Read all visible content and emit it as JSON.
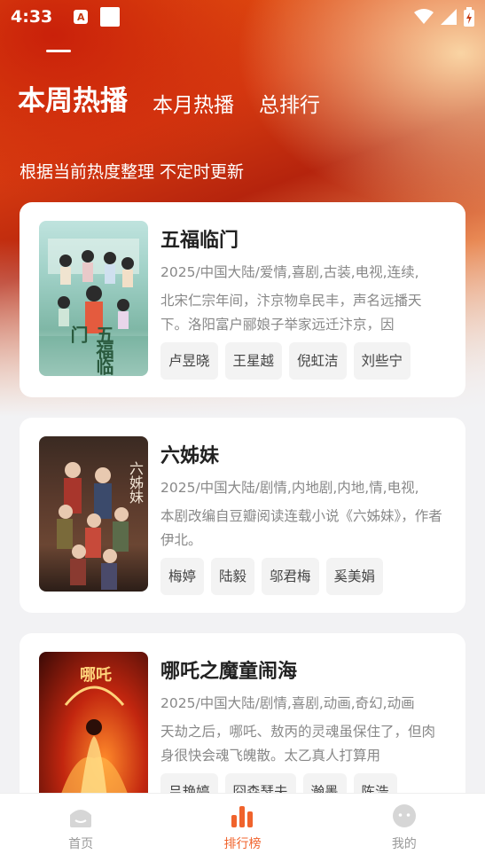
{
  "status": {
    "time": "4:33",
    "a_icon": "A"
  },
  "tabs": [
    {
      "label": "本周热播"
    },
    {
      "label": "本月热播"
    },
    {
      "label": "总排行"
    }
  ],
  "subtitle": "根据当前热度整理 不定时更新",
  "items": [
    {
      "title": "五福临门",
      "meta": "2025/中国大陆/爱情,喜剧,古装,电视,连续,",
      "desc": "北宋仁宗年间，汴京物阜民丰，声名远播天下。洛阳富户郦娘子举家远迁汴京，因",
      "cast": [
        "卢昱晓",
        "王星越",
        "倪虹洁",
        "刘些宁"
      ],
      "poster_text": "五福临门"
    },
    {
      "title": "六姊妹",
      "meta": "2025/中国大陆/剧情,内地剧,内地,情,电视,",
      "desc": "本剧改编自豆瓣阅读连载小说《六姊妹》，作者伊北。",
      "cast": [
        "梅婷",
        "陆毅",
        "邬君梅",
        "奚美娟"
      ],
      "poster_text": "六姊妹"
    },
    {
      "title": "哪吒之魔童闹海",
      "meta": "2025/中国大陆/剧情,喜剧,动画,奇幻,动画",
      "desc": "天劫之后，哪吒、敖丙的灵魂虽保住了，但肉身很快会魂飞魄散。太乙真人打算用",
      "cast": [
        "吕艳婷",
        "囧森瑟夫",
        "瀚墨",
        "陈浩"
      ],
      "poster_text": "哪吒"
    }
  ],
  "nav": [
    {
      "label": "首页"
    },
    {
      "label": "排行榜"
    },
    {
      "label": "我的"
    }
  ],
  "colors": {
    "accent": "#f0632c",
    "hero_red": "#c8280d",
    "hero_orange": "#e7580f"
  }
}
